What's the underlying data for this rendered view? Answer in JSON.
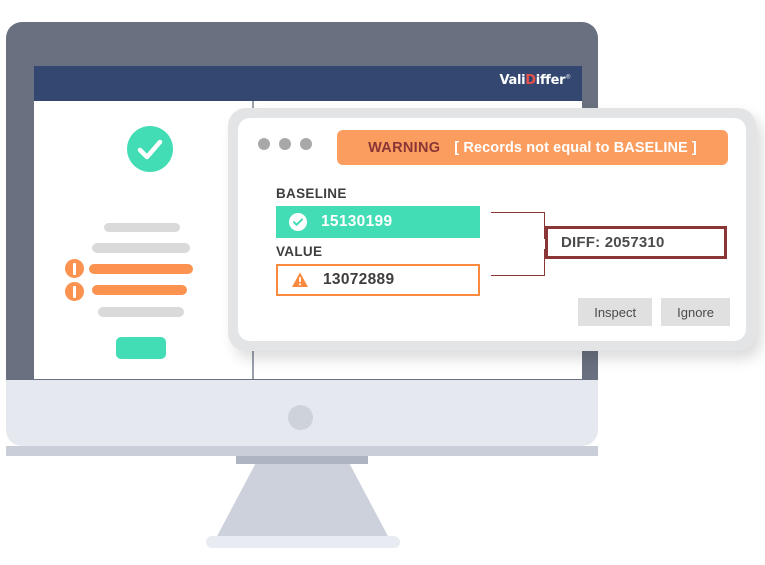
{
  "brand": {
    "name_part1": "Vali",
    "name_part2": "D",
    "name_part3": "iffer",
    "trademark": "®"
  },
  "background_screen": {
    "left_panel": {
      "status_icon": "check-circle-icon",
      "placeholder_bars": [
        {
          "state": "neutral"
        },
        {
          "state": "neutral"
        },
        {
          "state": "alert"
        },
        {
          "state": "alert"
        },
        {
          "state": "neutral"
        }
      ],
      "primary_button_label": ""
    },
    "right_panel": {
      "status_icon": "check-circle-icon"
    }
  },
  "dialog": {
    "window_controls": [
      "close-dot",
      "minimize-dot",
      "maximize-dot"
    ],
    "banner": {
      "severity_label": "WARNING",
      "message": "[ Records not equal to BASELINE ]",
      "background_color": "#fb9d5f",
      "severity_color": "#8a3536",
      "message_color": "#ffffff"
    },
    "fields": [
      {
        "label": "BASELINE",
        "value": "15130199",
        "icon": "check-circle-icon",
        "status": "ok",
        "color": "#42dcb5"
      },
      {
        "label": "VALUE",
        "value": "13072889",
        "icon": "warning-triangle-icon",
        "status": "warning",
        "color": "#f98a3f"
      }
    ],
    "diff": {
      "text": "DIFF: 2057310",
      "border_color": "#8a3536"
    },
    "actions": [
      {
        "label": "Inspect"
      },
      {
        "label": "Ignore"
      }
    ]
  },
  "hardware": {
    "bezel_color": "#697181",
    "chin_color": "#e5e8ee",
    "screen_header_color": "#344770"
  }
}
